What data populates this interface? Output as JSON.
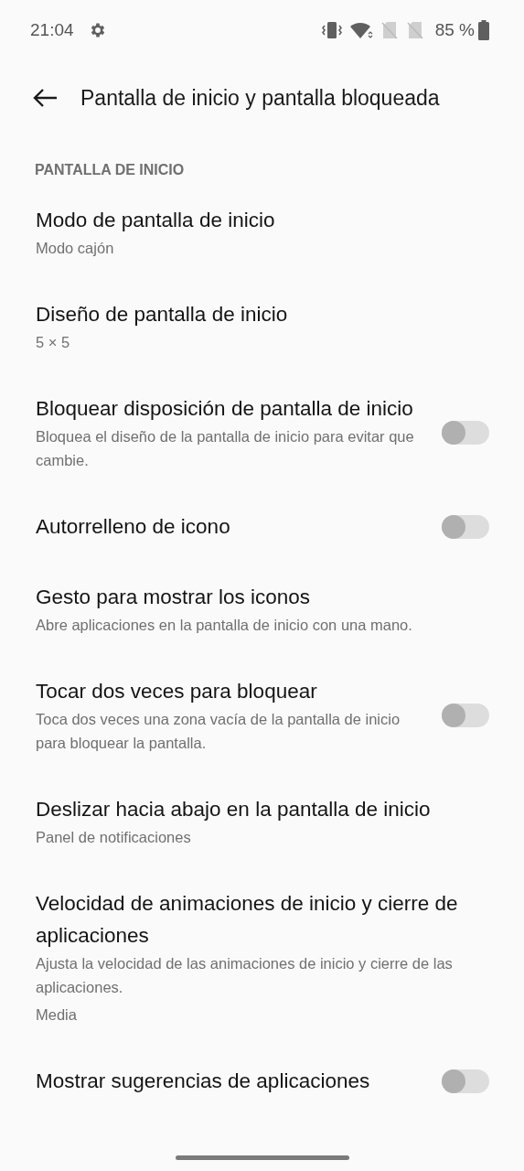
{
  "status_bar": {
    "time": "21:04",
    "battery": "85 %"
  },
  "header": {
    "title": "Pantalla de inicio y pantalla bloqueada"
  },
  "section": {
    "title": "PANTALLA DE INICIO"
  },
  "items": [
    {
      "kind": "nav",
      "title": "Modo de pantalla de inicio",
      "summary": "Modo cajón"
    },
    {
      "kind": "nav",
      "title": "Diseño de pantalla de inicio",
      "summary": "5 × 5"
    },
    {
      "kind": "switch",
      "title": "Bloquear disposición de pantalla de inicio",
      "summary": "Bloquea el diseño de la pantalla de inicio para evitar que cambie.",
      "on": false
    },
    {
      "kind": "switch",
      "title": "Autorrelleno de icono",
      "on": false
    },
    {
      "kind": "nav",
      "title": "Gesto para mostrar los iconos",
      "summary": "Abre aplicaciones en la pantalla de inicio con una mano."
    },
    {
      "kind": "switch",
      "title": "Tocar dos veces para bloquear",
      "summary": "Toca dos veces una zona vacía de la pantalla de inicio para bloquear la pantalla.",
      "on": false
    },
    {
      "kind": "nav",
      "title": "Deslizar hacia abajo en la pantalla de inicio",
      "summary": "Panel de notificaciones"
    },
    {
      "kind": "nav",
      "title": "Velocidad de animaciones de inicio y cierre de aplicaciones",
      "summary": "Ajusta la velocidad de las animaciones de inicio y cierre de las aplicaciones.",
      "value": "Media"
    },
    {
      "kind": "switch",
      "title": "Mostrar sugerencias de aplicaciones",
      "on": false
    }
  ]
}
